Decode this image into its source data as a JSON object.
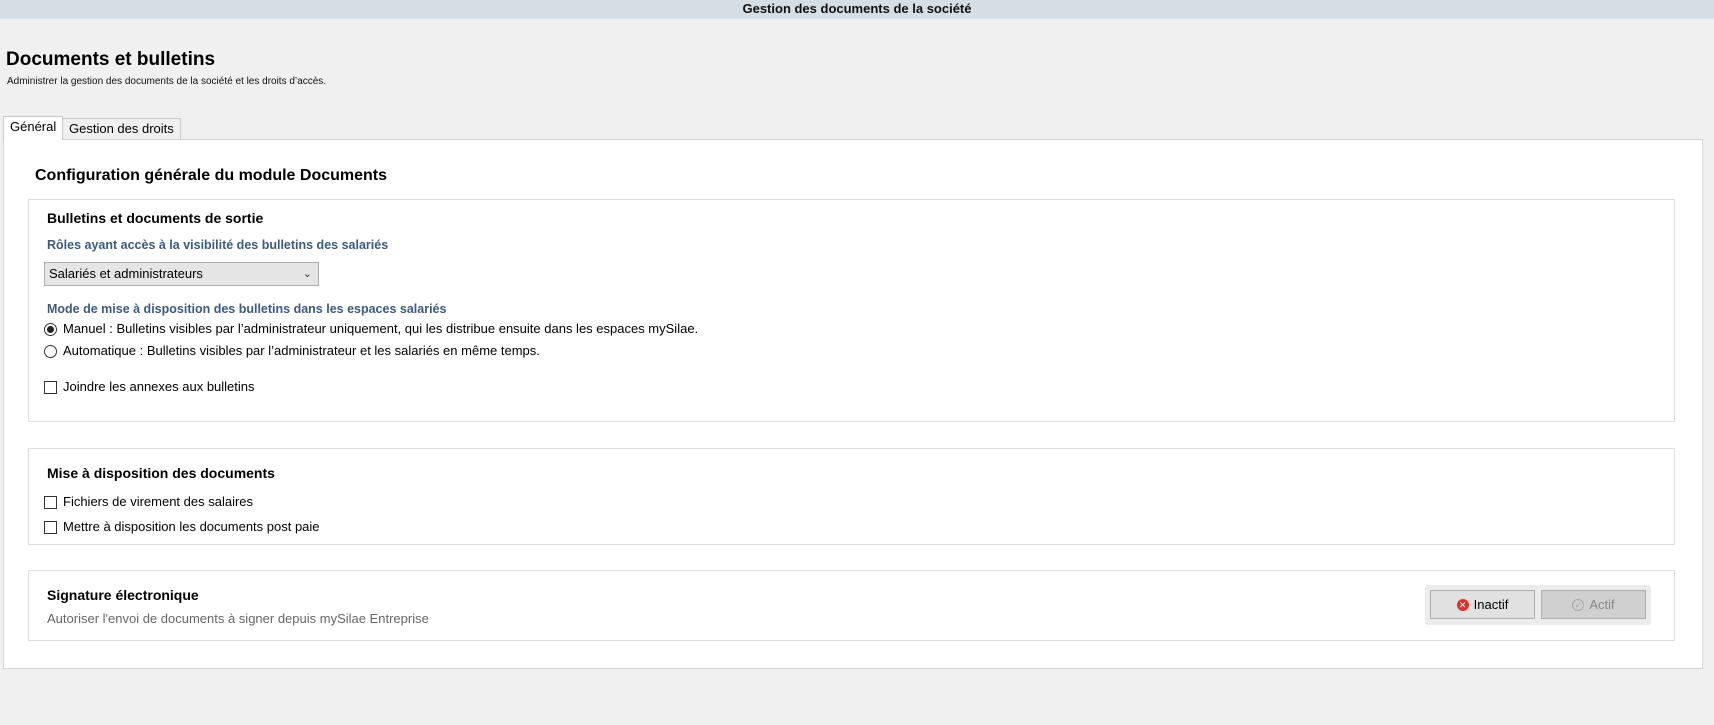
{
  "window": {
    "title": "Gestion des documents de la société"
  },
  "header": {
    "title": "Documents et bulletins",
    "subtitle": "Administrer la gestion des documents de la société et les droits d’accès."
  },
  "tabs": [
    {
      "label": "Général",
      "active": true
    },
    {
      "label": "Gestion des droits",
      "active": false
    }
  ],
  "main": {
    "heading": "Configuration générale du module Documents",
    "bulletins": {
      "title": "Bulletins et documents de sortie",
      "roles_label": "Rôles ayant accès à la visibilité des bulletins des salariés",
      "roles_value": "Salariés et administrateurs",
      "mode_label": "Mode de mise à disposition des bulletins dans les espaces salariés",
      "mode_options": [
        {
          "label": "Manuel : Bulletins visibles par l’administrateur uniquement, qui les distribue ensuite dans les espaces mySilae.",
          "checked": true
        },
        {
          "label": "Automatique : Bulletins visibles par l’administrateur et les salariés en même temps.",
          "checked": false
        }
      ],
      "annexes": {
        "label": "Joindre les annexes aux bulletins",
        "checked": false
      }
    },
    "documents": {
      "title": "Mise à disposition des documents",
      "options": [
        {
          "label": "Fichiers de virement des salaires",
          "checked": false
        },
        {
          "label": "Mettre à disposition les documents post paie",
          "checked": false
        }
      ]
    },
    "signature": {
      "title": "Signature électronique",
      "description": "Autoriser l'envoi de documents à signer depuis mySilae Entreprise",
      "inactive_label": "Inactif",
      "active_label": "Actif",
      "state": "Inactif"
    }
  },
  "icons": {
    "inactive": "x-circle-icon",
    "active": "check-circle-icon"
  },
  "colors": {
    "label_blue": "#3c5a82",
    "inactive_red": "#d9322c"
  }
}
